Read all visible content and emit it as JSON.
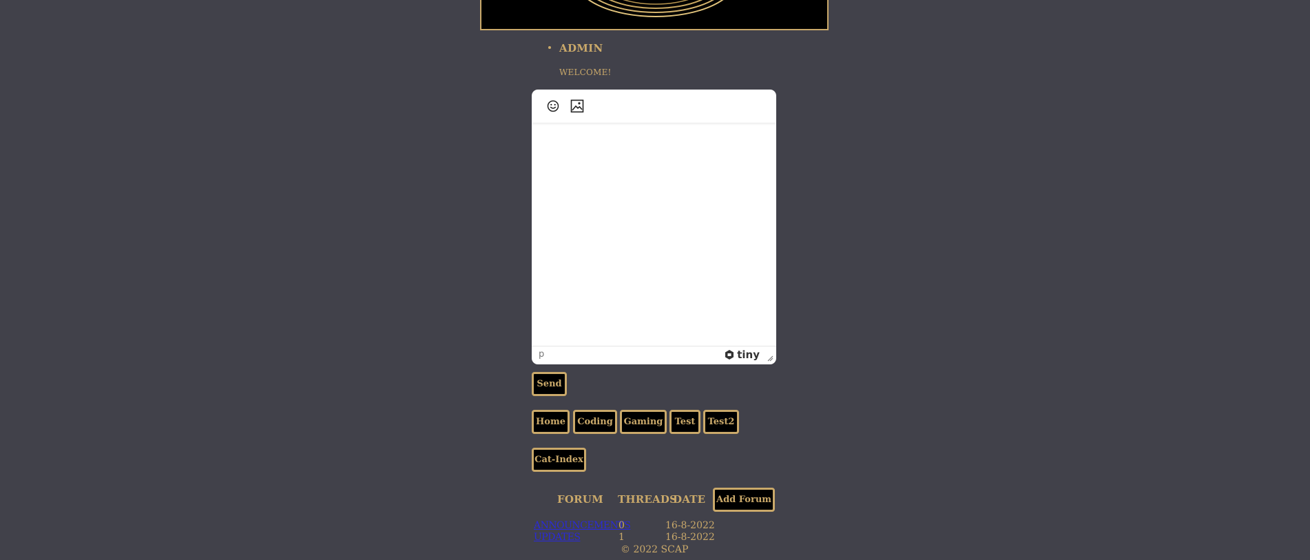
{
  "header": {
    "banner_logo": "gold-rings-logo"
  },
  "user": {
    "name": "ADMIN",
    "welcome": "WELCOME!"
  },
  "editor": {
    "toolbar": {
      "emoji_icon": "emoticon-icon",
      "image_icon": "image-icon"
    },
    "status_path": "p",
    "brand": "tiny"
  },
  "actions": {
    "send_label": "Send"
  },
  "nav": {
    "items": [
      {
        "label": "Home"
      },
      {
        "label": "Coding"
      },
      {
        "label": "Gaming"
      },
      {
        "label": "Test"
      },
      {
        "label": "Test2"
      }
    ],
    "cat_index_label": "Cat-Index"
  },
  "forum_table": {
    "headers": {
      "forum": "FORUM",
      "threads": "THREADS",
      "date": "DATE"
    },
    "add_forum_label": "Add Forum",
    "rows": [
      {
        "forum": "ANNOUNCEMENTS",
        "threads": "0",
        "date": "16-8-2022"
      },
      {
        "forum": "UPDATES",
        "threads": "1",
        "date": "16-8-2022"
      }
    ]
  },
  "footer": {
    "text": "© 2022 SCAP"
  },
  "colors": {
    "background": "#41414a",
    "gold": "#caa96a",
    "link": "#2a2ad8"
  }
}
